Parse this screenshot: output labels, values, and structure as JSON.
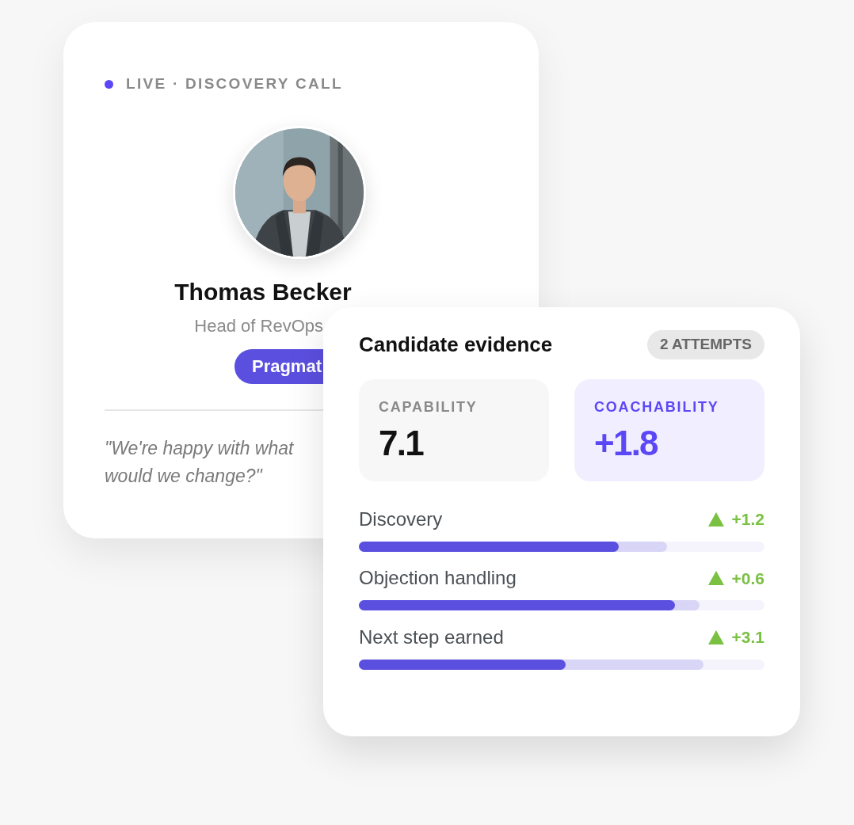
{
  "call_card": {
    "status": "LIVE · DISCOVERY CALL",
    "avatar": {
      "kind": "picture"
    },
    "name": "Thomas Becker",
    "role": "Head of RevOps",
    "badge": "Pragmat",
    "quote_lines": [
      "\"We're happy with what",
      "would we change?\""
    ]
  },
  "evidence_card": {
    "title": "Candidate evidence",
    "attempts": "2 ATTEMPTS",
    "stats": [
      {
        "kind": "plain",
        "label": "CAPABILITY",
        "value": "7.1"
      },
      {
        "kind": "accent",
        "label": "COACHABILITY",
        "value": "+1.8"
      }
    ],
    "skills": [
      {
        "label": "Discovery",
        "delta": "+1.2",
        "bars": [
          {
            "kind": "current",
            "level": 0.64
          },
          {
            "kind": "previous",
            "level": 0.76
          }
        ]
      },
      {
        "label": "Objection handling",
        "delta": "+0.6",
        "bars": [
          {
            "kind": "current",
            "level": 0.78
          },
          {
            "kind": "previous",
            "level": 0.84
          }
        ]
      },
      {
        "label": "Next step earned",
        "delta": "+3.1",
        "bars": [
          {
            "kind": "current",
            "level": 0.51
          },
          {
            "kind": "previous",
            "level": 0.85
          }
        ]
      }
    ]
  }
}
